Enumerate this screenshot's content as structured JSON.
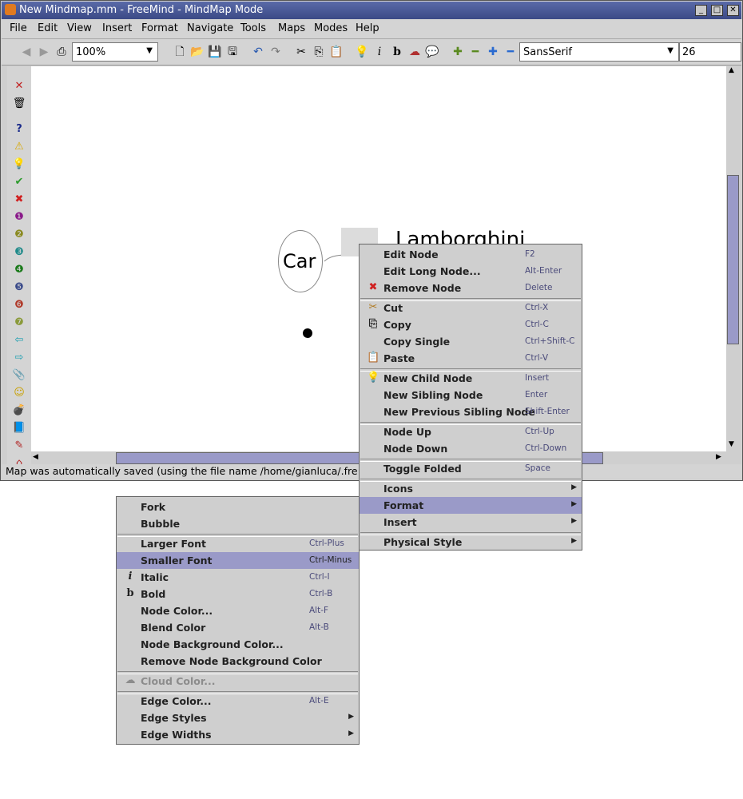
{
  "window": {
    "title": "New Mindmap.mm - FreeMind - MindMap Mode"
  },
  "menubar": [
    "File",
    "Edit",
    "View",
    "Insert",
    "Format",
    "Navigate",
    "Tools",
    "Maps",
    "Modes",
    "Help"
  ],
  "toolbar": {
    "zoom": "100%",
    "font_family": "SansSerif",
    "font_size": "26"
  },
  "canvas": {
    "root_node": "Car",
    "child_node": "Lamborghini"
  },
  "status": "Map was automatically saved (using the file name /home/gianluca/.fre",
  "context_menu": [
    {
      "label": "Edit Node",
      "shortcut": "F2"
    },
    {
      "label": "Edit Long Node...",
      "shortcut": "Alt-Enter"
    },
    {
      "label": "Remove Node",
      "shortcut": "Delete",
      "icon": "remove-icon"
    },
    {
      "label": "Cut",
      "shortcut": "Ctrl-X",
      "icon": "cut-icon"
    },
    {
      "label": "Copy",
      "shortcut": "Ctrl-C",
      "icon": "copy-icon"
    },
    {
      "label": "Copy Single",
      "shortcut": "Ctrl+Shift-C"
    },
    {
      "label": "Paste",
      "shortcut": "Ctrl-V",
      "icon": "paste-icon"
    },
    {
      "label": "New Child Node",
      "shortcut": "Insert",
      "icon": "bulb-icon"
    },
    {
      "label": "New Sibling Node",
      "shortcut": "Enter"
    },
    {
      "label": "New Previous Sibling Node",
      "shortcut": "Shift-Enter"
    },
    {
      "label": "Node Up",
      "shortcut": "Ctrl-Up"
    },
    {
      "label": "Node Down",
      "shortcut": "Ctrl-Down"
    },
    {
      "label": "Toggle Folded",
      "shortcut": "Space"
    },
    {
      "label": "Icons",
      "shortcut": ""
    },
    {
      "label": "Format",
      "shortcut": ""
    },
    {
      "label": "Insert",
      "shortcut": ""
    },
    {
      "label": "Physical Style",
      "shortcut": ""
    }
  ],
  "format_submenu": [
    {
      "label": "Fork",
      "shortcut": ""
    },
    {
      "label": "Bubble",
      "shortcut": ""
    },
    {
      "label": "Larger Font",
      "shortcut": "Ctrl-Plus"
    },
    {
      "label": "Smaller Font",
      "shortcut": "Ctrl-Minus"
    },
    {
      "label": "Italic",
      "shortcut": "Ctrl-I",
      "icon": "italic-icon"
    },
    {
      "label": "Bold",
      "shortcut": "Ctrl-B",
      "icon": "bold-icon"
    },
    {
      "label": "Node Color...",
      "shortcut": "Alt-F"
    },
    {
      "label": "Blend Color",
      "shortcut": "Alt-B"
    },
    {
      "label": "Node Background Color...",
      "shortcut": ""
    },
    {
      "label": "Remove Node Background Color",
      "shortcut": ""
    },
    {
      "label": "Cloud Color...",
      "shortcut": "",
      "icon": "cloud-icon"
    },
    {
      "label": "Edge Color...",
      "shortcut": "Alt-E"
    },
    {
      "label": "Edge Styles",
      "shortcut": ""
    },
    {
      "label": "Edge Widths",
      "shortcut": ""
    }
  ]
}
